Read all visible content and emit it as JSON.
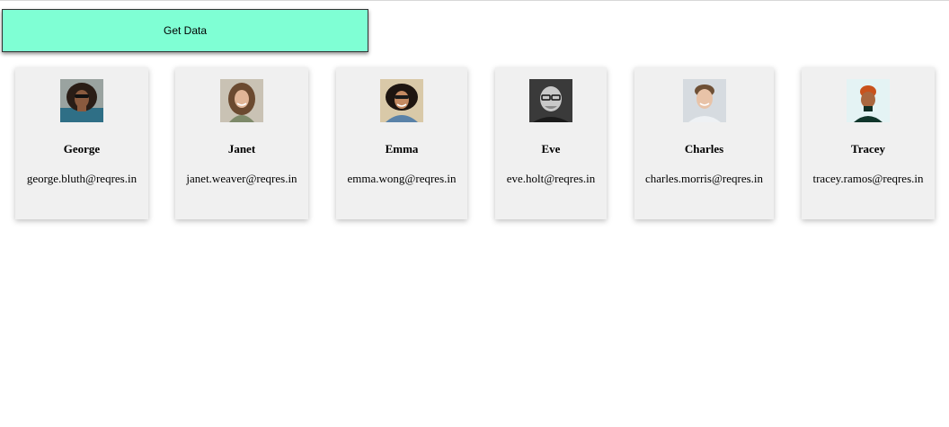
{
  "button": {
    "label": "Get Data",
    "color": "#7fffd4"
  },
  "users": [
    {
      "first_name": "George",
      "email": "george.bluth@reqres.in",
      "avatar": "george-avatar"
    },
    {
      "first_name": "Janet",
      "email": "janet.weaver@reqres.in",
      "avatar": "janet-avatar"
    },
    {
      "first_name": "Emma",
      "email": "emma.wong@reqres.in",
      "avatar": "emma-avatar"
    },
    {
      "first_name": "Eve",
      "email": "eve.holt@reqres.in",
      "avatar": "eve-avatar"
    },
    {
      "first_name": "Charles",
      "email": "charles.morris@reqres.in",
      "avatar": "charles-avatar"
    },
    {
      "first_name": "Tracey",
      "email": "tracey.ramos@reqres.in",
      "avatar": "tracey-avatar"
    }
  ]
}
